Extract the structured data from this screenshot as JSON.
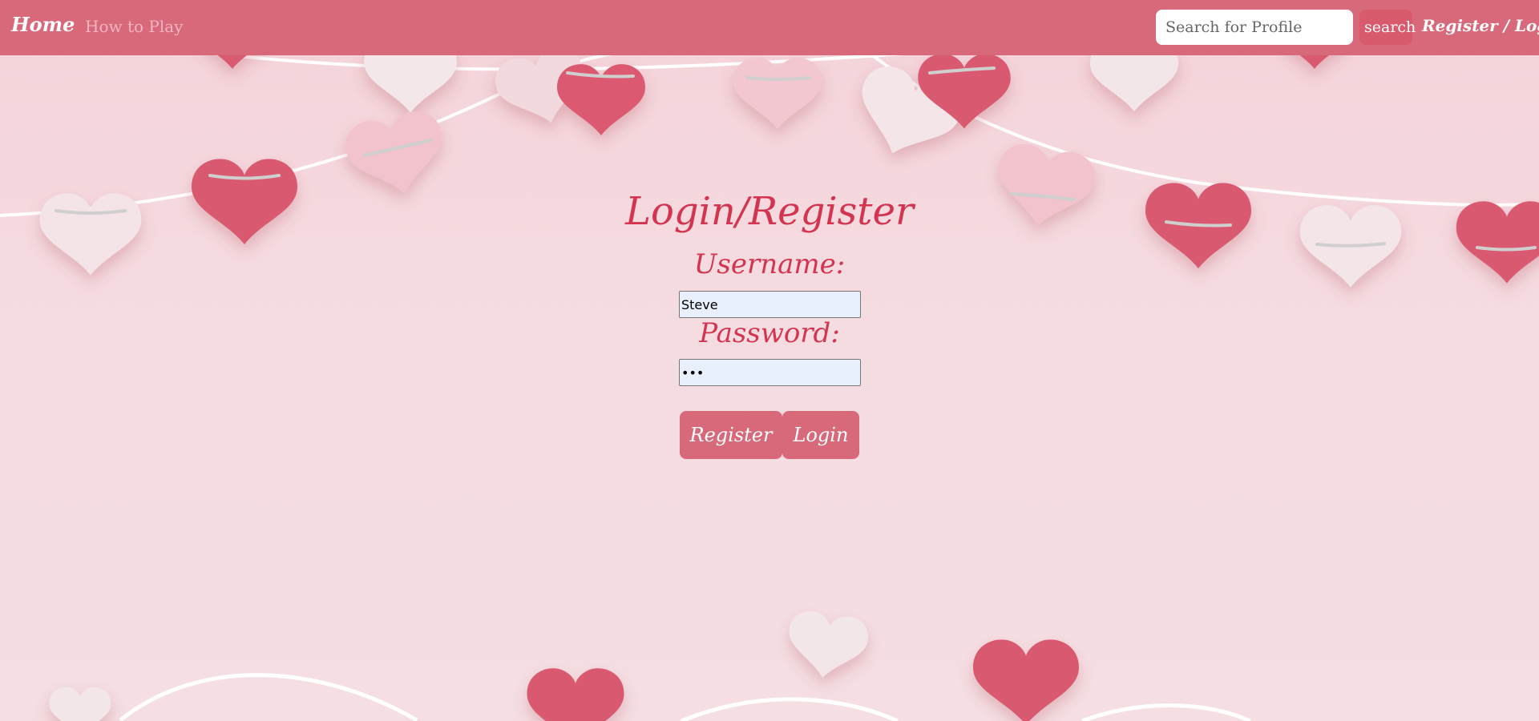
{
  "nav": {
    "home": "Home",
    "how_to_play": "How to Play",
    "search_placeholder": "Search for Profile",
    "search_button": "search",
    "register_login": "Register / Login"
  },
  "form": {
    "title": "Login/Register",
    "username_label": "Username:",
    "username_value": "Steve",
    "password_label": "Password:",
    "password_value": "abc",
    "register_button": "Register",
    "login_button": "Login"
  },
  "colors": {
    "navbar": "#d8697a",
    "accent_text": "#d3344f",
    "background": "#f5d8dd"
  },
  "icons": [
    "heart-garland-decoration"
  ]
}
